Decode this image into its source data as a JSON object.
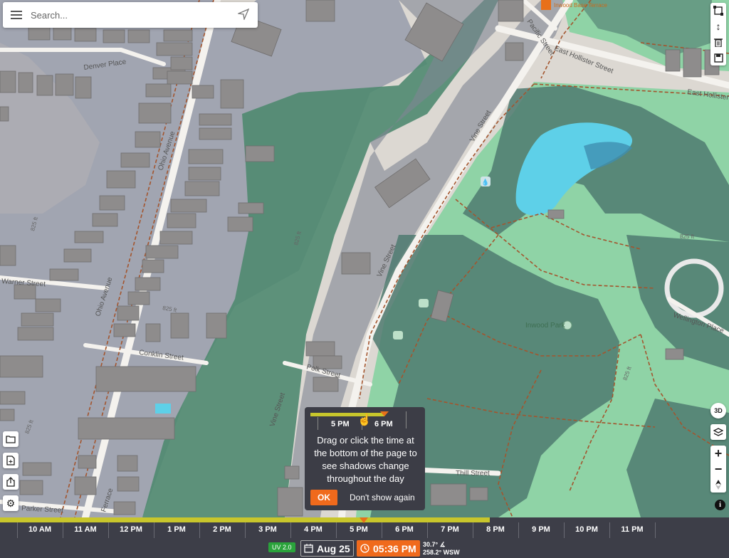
{
  "search": {
    "placeholder": "Search..."
  },
  "map": {
    "streets": [
      {
        "id": "denver",
        "name": "Denver Place"
      },
      {
        "id": "vine1",
        "name": "Vine Street"
      },
      {
        "id": "vine2",
        "name": "Vine Street"
      },
      {
        "id": "vine3",
        "name": "Vine Street"
      },
      {
        "id": "hollister1",
        "name": "East Hollister Street"
      },
      {
        "id": "hollister2",
        "name": "East Hollister"
      },
      {
        "id": "warner",
        "name": "Warner Street"
      },
      {
        "id": "conklin",
        "name": "Conklin Street"
      },
      {
        "id": "polk",
        "name": "Polk Street"
      },
      {
        "id": "thill",
        "name": "Thill Street"
      },
      {
        "id": "parker",
        "name": "Parker Street"
      },
      {
        "id": "wellington",
        "name": "Wellington Place"
      },
      {
        "id": "ohio1",
        "name": "Ohio Avenue"
      },
      {
        "id": "ohio2",
        "name": "Ohio Avenue"
      },
      {
        "id": "ferrace",
        "name": "Ferrace"
      },
      {
        "id": "pacific",
        "name": "Pacific Street"
      }
    ],
    "elevations": [
      "825 ft",
      "825 ft",
      "825 ft",
      "825 ft",
      "825 ft",
      "825 ft"
    ],
    "places": {
      "park": "Inwood Park",
      "poi": "Inwood Base Terrace"
    }
  },
  "toolbar_top": {
    "icons": [
      "polygon-icon",
      "height-arrows-icon",
      "trash-icon",
      "save-icon"
    ]
  },
  "toolbar_left": {
    "icons": [
      "folder-icon",
      "add-file-icon",
      "share-icon",
      "settings-icon"
    ]
  },
  "toolbar_right": {
    "icons": [
      "3d-rotate-icon",
      "layers-icon",
      "zoom-in-icon",
      "zoom-out-icon",
      "compass-icon",
      "info-icon"
    ]
  },
  "tooltip": {
    "times": [
      "5 PM",
      "6 PM"
    ],
    "message": "Drag or click the time at the bottom of the page to see shadows change throughout the day",
    "ok_label": "OK",
    "dont_show_label": "Don't show again"
  },
  "timeline": {
    "hours": [
      "10 AM",
      "11 AM",
      "12 PM",
      "1 PM",
      "2 PM",
      "3 PM",
      "4 PM",
      "5 PM",
      "6 PM",
      "7 PM",
      "8 PM",
      "9 PM",
      "10 PM",
      "11 PM"
    ],
    "uv_label": "UV 2.0",
    "date": "Aug 25",
    "time": "05:36 PM",
    "sun_altitude": "30.7°",
    "sun_azimuth": "258.2° WSW"
  },
  "colors": {
    "accent": "#f06a1c",
    "timeline_bar": "#c8c62c",
    "panel": "#3d3e48",
    "uv": "#2aa33b",
    "park": "#8fd3a6",
    "shadow": "#4f7a70",
    "water": "#5ed0e8"
  }
}
